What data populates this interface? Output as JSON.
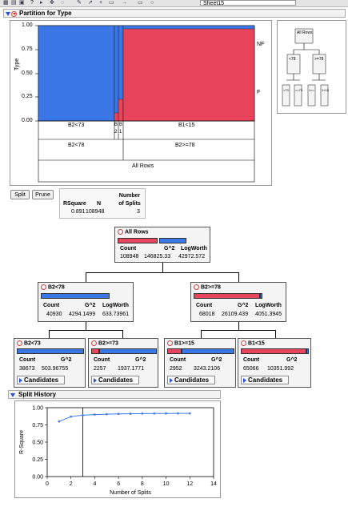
{
  "toolbar": {
    "sheet_select": "Sheet15"
  },
  "partition_panel": {
    "title": "Partition for Type",
    "y_axis_label": "Type",
    "y_ticks": [
      "1.00",
      "0.75",
      "0.50",
      "0.25",
      "0.00"
    ],
    "legend_right": [
      "NF",
      "F"
    ],
    "level3_labels": [
      "B2<73",
      "B",
      "B",
      "B1<15"
    ],
    "level3_sub": [
      "2",
      "1"
    ],
    "level2_labels": [
      "B2<78",
      "B2>=78"
    ],
    "level1_label": "All Rows",
    "mini_tree": {
      "root": "All Rows",
      "left": "<78",
      "right": ">=78",
      "leaves": [
        "<73",
        ">=73",
        "1>=",
        "1<15"
      ]
    }
  },
  "buttons": {
    "split": "Split",
    "prune": "Prune"
  },
  "summary": {
    "headers": [
      "RSquare",
      "N",
      "Number of Splits"
    ],
    "values": [
      "0.891",
      "108948",
      "3"
    ]
  },
  "tree": {
    "root": {
      "name": "All Rows",
      "cols": [
        "Count",
        "G^2",
        "LogWorth"
      ],
      "vals": [
        "108948",
        "146825.33",
        "42972.572"
      ]
    },
    "left": {
      "name": "B2<78",
      "cols": [
        "Count",
        "G^2",
        "LogWorth"
      ],
      "vals": [
        "40930",
        "4294.1499",
        "633.73961"
      ]
    },
    "right": {
      "name": "B2>=78",
      "cols": [
        "Count",
        "G^2",
        "LogWorth"
      ],
      "vals": [
        "68018",
        "26109.439",
        "4051.3945"
      ]
    },
    "ll": {
      "name": "B2<73",
      "cols": [
        "Count",
        "G^2"
      ],
      "vals": [
        "38673",
        "503.96755"
      ]
    },
    "lr": {
      "name": "B2>=73",
      "cols": [
        "Count",
        "G^2"
      ],
      "vals": [
        "2257",
        "1937.1771"
      ]
    },
    "rl": {
      "name": "B1>=15",
      "cols": [
        "Count",
        "G^2"
      ],
      "vals": [
        "2952",
        "3243.2106"
      ]
    },
    "rr": {
      "name": "B1<15",
      "cols": [
        "Count",
        "G^2"
      ],
      "vals": [
        "65066",
        "10351.992"
      ]
    },
    "candidates_label": "Candidates"
  },
  "split_history": {
    "title": "Split History"
  },
  "chart_data": {
    "type": "line",
    "title": "",
    "xlabel": "Number of Splits",
    "ylabel": "R-Square",
    "xlim": [
      0,
      14
    ],
    "ylim": [
      0,
      1
    ],
    "x_ticks": [
      "0",
      "2",
      "4",
      "6",
      "8",
      "10",
      "12",
      "14"
    ],
    "y_ticks": [
      "0.00",
      "0.25",
      "0.50",
      "0.75",
      "1.00"
    ],
    "vertical_marker_x": 3,
    "series": [
      {
        "x": [
          1,
          2,
          3,
          4,
          5,
          6,
          7,
          8,
          9,
          10,
          11,
          12
        ],
        "values": [
          0.8,
          0.87,
          0.891,
          0.9,
          0.905,
          0.91,
          0.912,
          0.914,
          0.915,
          0.916,
          0.917,
          0.917
        ]
      }
    ],
    "colors": {
      "line": "#3a76e6"
    }
  }
}
